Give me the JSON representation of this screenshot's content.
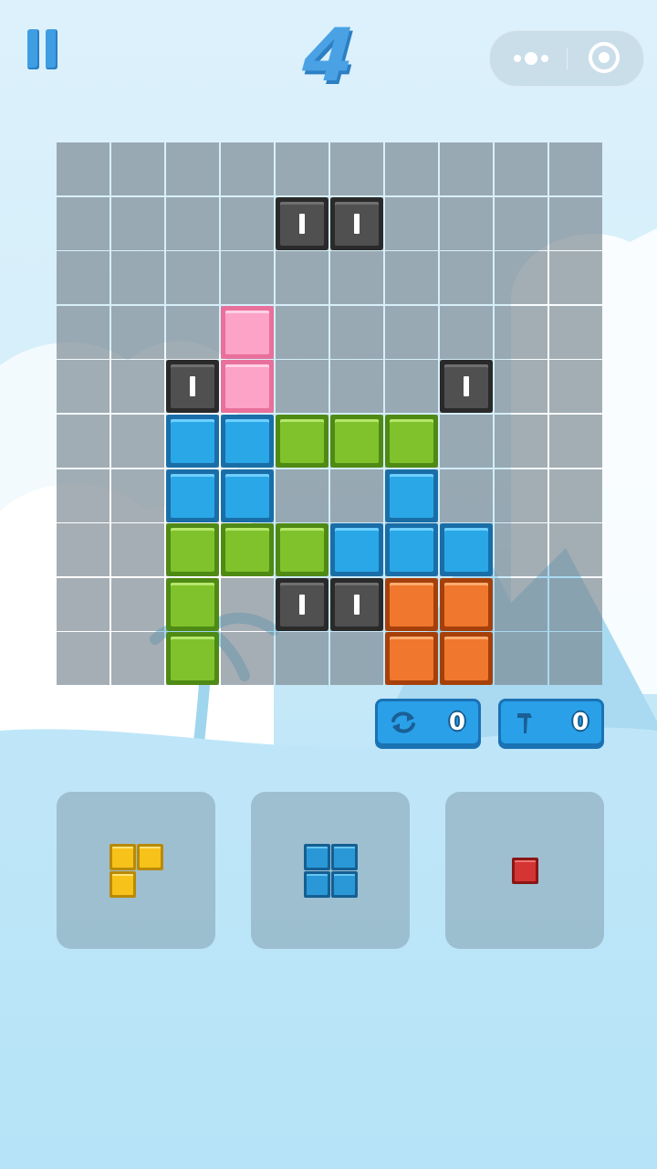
{
  "header": {
    "score": "4"
  },
  "colors": {
    "pink": "#fca3c7",
    "blue": "#2aa7e6",
    "green": "#7fc22c",
    "orange": "#f0772e",
    "stone": "#505050",
    "yellow": "#f7c21a",
    "red": "#d43434",
    "button": "#2aa0e8"
  },
  "board": {
    "columns": 10,
    "rows": 10,
    "blocks": [
      {
        "row": 1,
        "col": 4,
        "kind": "stone"
      },
      {
        "row": 1,
        "col": 5,
        "kind": "stone"
      },
      {
        "row": 3,
        "col": 3,
        "kind": "pink"
      },
      {
        "row": 4,
        "col": 2,
        "kind": "stone"
      },
      {
        "row": 4,
        "col": 3,
        "kind": "pink"
      },
      {
        "row": 4,
        "col": 7,
        "kind": "stone"
      },
      {
        "row": 5,
        "col": 2,
        "kind": "blue"
      },
      {
        "row": 5,
        "col": 3,
        "kind": "blue"
      },
      {
        "row": 5,
        "col": 4,
        "kind": "green"
      },
      {
        "row": 5,
        "col": 5,
        "kind": "green"
      },
      {
        "row": 5,
        "col": 6,
        "kind": "green"
      },
      {
        "row": 6,
        "col": 2,
        "kind": "blue"
      },
      {
        "row": 6,
        "col": 3,
        "kind": "blue"
      },
      {
        "row": 6,
        "col": 6,
        "kind": "blue"
      },
      {
        "row": 7,
        "col": 2,
        "kind": "green"
      },
      {
        "row": 7,
        "col": 3,
        "kind": "green"
      },
      {
        "row": 7,
        "col": 4,
        "kind": "green"
      },
      {
        "row": 7,
        "col": 5,
        "kind": "blue"
      },
      {
        "row": 7,
        "col": 6,
        "kind": "blue"
      },
      {
        "row": 7,
        "col": 7,
        "kind": "blue"
      },
      {
        "row": 8,
        "col": 2,
        "kind": "green"
      },
      {
        "row": 8,
        "col": 4,
        "kind": "stone"
      },
      {
        "row": 8,
        "col": 5,
        "kind": "stone"
      },
      {
        "row": 8,
        "col": 6,
        "kind": "orange"
      },
      {
        "row": 8,
        "col": 7,
        "kind": "orange"
      },
      {
        "row": 9,
        "col": 2,
        "kind": "green"
      },
      {
        "row": 9,
        "col": 6,
        "kind": "orange"
      },
      {
        "row": 9,
        "col": 7,
        "kind": "orange"
      }
    ]
  },
  "tools": {
    "refresh": {
      "icon": "refresh-icon",
      "count": "0"
    },
    "hammer": {
      "icon": "hammer-icon",
      "count": "0"
    }
  },
  "pieces": [
    {
      "name": "piece-yellow-l",
      "color": "yellow",
      "cells": [
        [
          0,
          0
        ],
        [
          0,
          1
        ],
        [
          1,
          0
        ]
      ]
    },
    {
      "name": "piece-blue-square",
      "color": "blue",
      "cells": [
        [
          0,
          0
        ],
        [
          0,
          1
        ],
        [
          1,
          0
        ],
        [
          1,
          1
        ]
      ]
    },
    {
      "name": "piece-red-single",
      "color": "red",
      "cells": [
        [
          0,
          0
        ]
      ]
    }
  ]
}
